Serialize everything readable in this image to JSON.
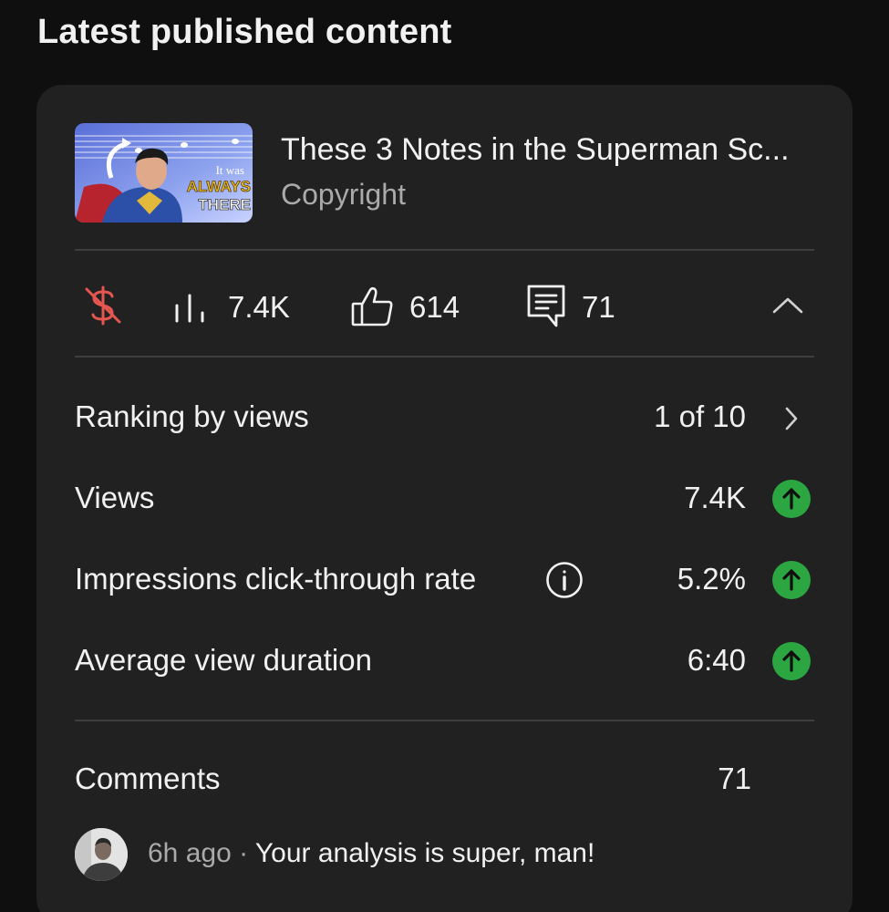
{
  "section": {
    "title": "Latest published content"
  },
  "video": {
    "title": "These 3 Notes in the Superman Sc...",
    "subtitle": "Copyright",
    "thumbnail": {
      "overlay_line1": "It was",
      "overlay_line2": "ALWAYS",
      "overlay_line3": "THERE"
    }
  },
  "stats": {
    "monetization_icon": "monetization-off-icon",
    "views": "7.4K",
    "likes": "614",
    "comments": "71",
    "collapse_icon": "chevron-up-icon"
  },
  "metrics": [
    {
      "label": "Ranking by views",
      "value": "1 of 10",
      "icon": "chevron-right-icon"
    },
    {
      "label": "Views",
      "value": "7.4K",
      "icon": "arrow-up-circle-icon"
    },
    {
      "label": "Impressions click-through rate",
      "value": "5.2%",
      "icon": "arrow-up-circle-icon",
      "info_icon": "info-icon"
    },
    {
      "label": "Average view duration",
      "value": "6:40",
      "icon": "arrow-up-circle-icon"
    }
  ],
  "comments": {
    "label": "Comments",
    "count": "71",
    "latest": {
      "time": "6h ago",
      "separator": "·",
      "text": "Your analysis is super, man!"
    }
  },
  "colors": {
    "background": "#0f0f0f",
    "card": "#212121",
    "positive": "#2ba640",
    "monetization_off": "#e4564f",
    "secondary_text": "#aaaaaa"
  }
}
